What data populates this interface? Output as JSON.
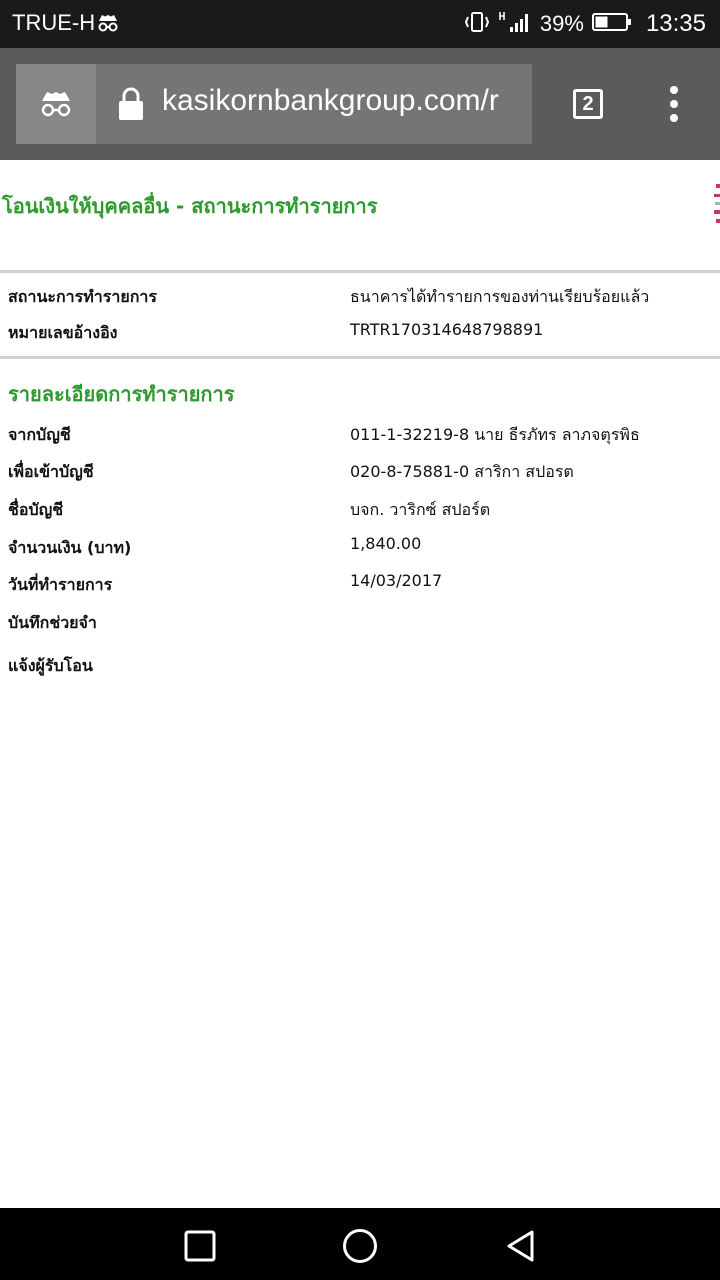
{
  "status_bar": {
    "carrier": "TRUE-H",
    "battery_percent": "39%",
    "time": "13:35"
  },
  "browser": {
    "url": "kasikornbankgroup.com/r",
    "tab_count": "2",
    "icons": [
      "incognito-icon",
      "lock-icon",
      "tab-switcher-icon",
      "overflow-menu-icon"
    ]
  },
  "page": {
    "title": "โอนเงินให้บุคคลอื่น - สถานะการทำรายการ",
    "status_label": "สถานะการทำรายการ",
    "status_value": "ธนาคารได้ทำรายการของท่านเรียบร้อยแล้ว",
    "reference_label": "หมายเลขอ้างอิง",
    "reference_value": "TRTR170314648798891",
    "details_heading": "รายละเอียดการทำรายการ",
    "details": [
      {
        "label": "จากบัญชี",
        "value": "011-1-32219-8 นาย ธีรภัทร ลาภจตุรพิธ"
      },
      {
        "label": "เพื่อเข้าบัญชี",
        "value": "020-8-75881-0 สาริกา สปอรต"
      },
      {
        "label": "ชื่อบัญชี",
        "value": "บจก. วาริกซ์ สปอร์ต"
      },
      {
        "label": "จำนวนเงิน (บาท)",
        "value": "1,840.00"
      },
      {
        "label": "วันที่ทำรายการ",
        "value": "14/03/2017"
      },
      {
        "label": "บันทึกช่วยจำ",
        "value": ""
      },
      {
        "label": "แจ้งผู้รับโอน",
        "value": ""
      }
    ]
  },
  "colors": {
    "accent_green": "#2e9a2e",
    "toolbar": "#5b5b5b",
    "status_bar": "#1a1a1a"
  }
}
